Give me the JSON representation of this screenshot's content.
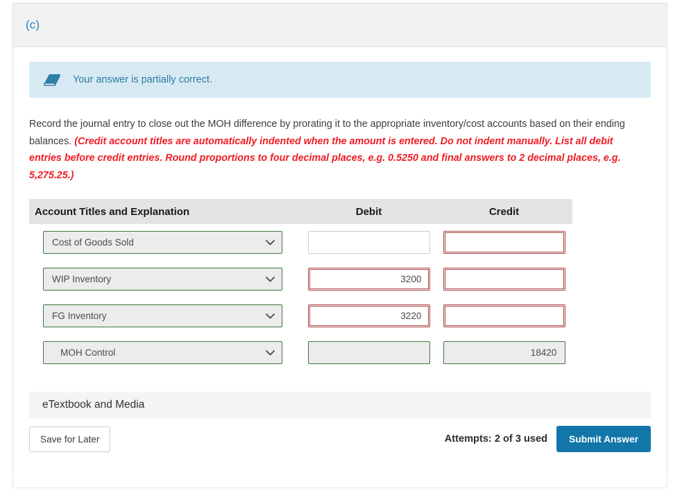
{
  "part": {
    "label": "(c)"
  },
  "alert": {
    "icon": "eraser-icon",
    "message": "Your answer is partially correct.",
    "background_color": "#d7eaf4",
    "text_color": "#2a7ca3"
  },
  "instructions": {
    "main": "Record the journal entry to close out the MOH difference by prorating it to the appropriate inventory/cost accounts based on their ending balances. ",
    "hint": "(Credit account titles are automatically indented when the amount is entered. Do not indent manually. List all debit entries before credit entries. Round proportions to four decimal places, e.g. 0.5250 and final answers to 2 decimal places, e.g. 5,275.25.)",
    "hint_color": "#ee1c25"
  },
  "journal": {
    "headers": {
      "account": "Account Titles and Explanation",
      "debit": "Debit",
      "credit": "Credit"
    },
    "rows": [
      {
        "account": "Cost of Goods Sold",
        "indented": false,
        "account_state": "correct",
        "debit": "",
        "debit_state": "neutral",
        "credit": "",
        "credit_state": "wrong",
        "disabled": false
      },
      {
        "account": "WIP Inventory",
        "indented": false,
        "account_state": "correct",
        "debit": "3200",
        "debit_state": "wrong",
        "credit": "",
        "credit_state": "wrong",
        "disabled": false
      },
      {
        "account": "FG Inventory",
        "indented": false,
        "account_state": "correct",
        "debit": "3220",
        "debit_state": "wrong",
        "credit": "",
        "credit_state": "wrong",
        "disabled": false
      },
      {
        "account": "MOH Control",
        "indented": true,
        "account_state": "correct",
        "debit": "",
        "debit_state": "ok-disabled",
        "credit": "18420",
        "credit_state": "ok-disabled",
        "disabled": true
      }
    ],
    "dropdown_icon": "chevron-down-icon",
    "correct_border_color": "#3c763d",
    "incorrect_border_color": "#a94442"
  },
  "etextbook": {
    "label": "eTextbook and Media"
  },
  "footer": {
    "save_label": "Save for Later",
    "attempts": "Attempts: 2 of 3 used",
    "submit_label": "Submit Answer",
    "submit_color": "#1277a8"
  }
}
